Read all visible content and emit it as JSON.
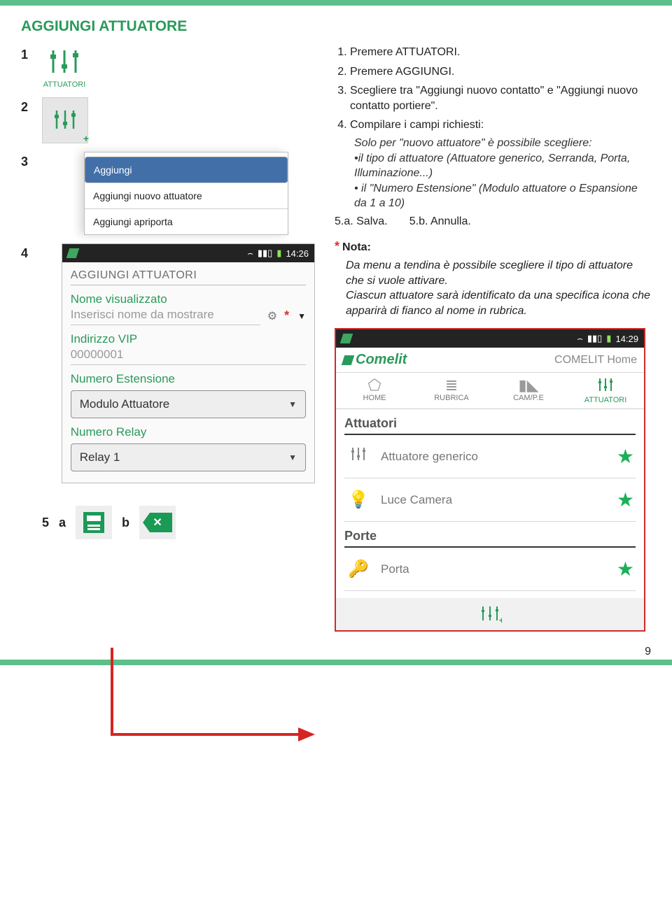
{
  "title": "AGGIUNGI ATTUATORE",
  "left": {
    "num1": "1",
    "num2": "2",
    "num3": "3",
    "num4": "4",
    "attuatori_label": "ATTUATORI",
    "menu": {
      "aggiungi": "Aggiungi",
      "item2": "Aggiungi nuovo attuatore",
      "item3": "Aggiungi apriporta"
    },
    "status_time": "14:26",
    "form": {
      "header": "AGGIUNGI ATTUATORI",
      "name_label": "Nome visualizzato",
      "name_placeholder": "Inserisci nome da mostrare",
      "vip_label": "Indirizzo VIP",
      "vip_value": "00000001",
      "ext_label": "Numero Estensione",
      "ext_value": "Modulo Attuatore",
      "relay_label": "Numero Relay",
      "relay_value": "Relay 1"
    },
    "ab": {
      "n": "5",
      "a": "a",
      "b": "b"
    }
  },
  "steps": {
    "s1": "Premere ATTUATORI.",
    "s2": "Premere AGGIUNGI.",
    "s3": "Scegliere tra \"Aggiungi nuovo contatto\" e \"Aggiungi nuovo contatto portiere\".",
    "s4": "Compilare i campi richiesti:",
    "s4a": "Solo per \"nuovo attuatore\" è possibile scegliere:",
    "s4b": "•il tipo di attuatore (Attuatore generico, Serranda, Porta, Illuminazione...)",
    "s4c": "• il \"Numero Estensione\" (Modulo attuatore o Espansione da 1 a 10)",
    "s5a": "5.a. Salva.",
    "s5b": "5.b. Annulla."
  },
  "note": {
    "title": "Nota:",
    "body1": "Da menu a tendina è possibile scegliere il tipo di attuatore che si vuole attivare.",
    "body2": "Ciascun attuatore sarà identificato da una specifica icona che apparirà di fianco al nome in rubrica."
  },
  "app": {
    "time": "14:29",
    "brand": "Comelit",
    "brandr": "COMELIT Home",
    "tabs": {
      "home": "HOME",
      "rubrica": "RUBRICA",
      "cam": "CAM/P.E",
      "att": "ATTUATORI"
    },
    "sec1": "Attuatori",
    "row1": "Attuatore generico",
    "row2": "Luce Camera",
    "sec2": "Porte",
    "row3": "Porta"
  },
  "page_number": "9"
}
